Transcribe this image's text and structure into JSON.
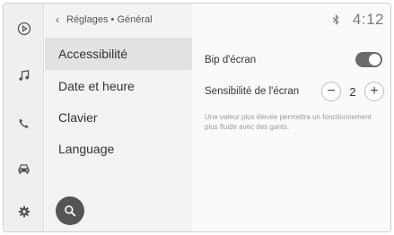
{
  "breadcrumb": {
    "text": "Réglages • Général"
  },
  "status": {
    "time": "4:12"
  },
  "menu": {
    "items": [
      {
        "label": "Accessibilité",
        "active": true
      },
      {
        "label": "Date et heure",
        "active": false
      },
      {
        "label": "Clavier",
        "active": false
      },
      {
        "label": "Language",
        "active": false
      }
    ]
  },
  "settings": {
    "beep_label": "Bip d'écran",
    "beep_on": true,
    "sensitivity_label": "Sensibilité de l'écran",
    "sensitivity_value": "2",
    "hint": "Une valeur plus élevée permettra un fonctionnement plus fluide avec des gants."
  },
  "rail": {
    "icons": [
      "media-source-icon",
      "music-note-icon",
      "phone-icon",
      "car-icon",
      "settings-gear-icon"
    ]
  },
  "colors": {
    "toggle_on": "#6a6a6a",
    "search_button": "#555555"
  }
}
